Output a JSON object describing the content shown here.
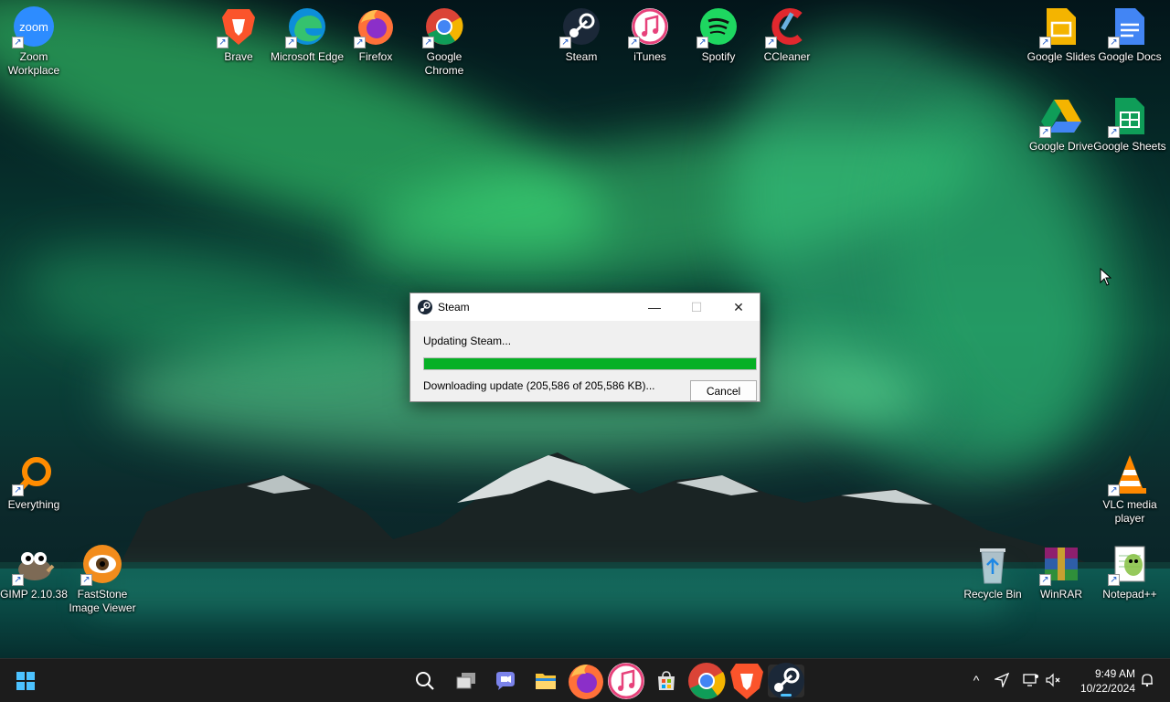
{
  "desktop_icons": [
    {
      "label": "Zoom Workplace",
      "icon": "zoom-icon"
    },
    {
      "label": "Brave",
      "icon": "brave-icon"
    },
    {
      "label": "Microsoft Edge",
      "icon": "edge-icon"
    },
    {
      "label": "Firefox",
      "icon": "firefox-icon"
    },
    {
      "label": "Google Chrome",
      "icon": "chrome-icon"
    },
    {
      "label": "Steam",
      "icon": "steam-icon"
    },
    {
      "label": "iTunes",
      "icon": "itunes-icon"
    },
    {
      "label": "Spotify",
      "icon": "spotify-icon"
    },
    {
      "label": "CCleaner",
      "icon": "ccleaner-icon"
    },
    {
      "label": "Google Slides",
      "icon": "google-slides-icon"
    },
    {
      "label": "Google Docs",
      "icon": "google-docs-icon"
    },
    {
      "label": "Google Drive",
      "icon": "google-drive-icon"
    },
    {
      "label": "Google Sheets",
      "icon": "google-sheets-icon"
    },
    {
      "label": "Everything",
      "icon": "everything-icon"
    },
    {
      "label": "VLC media player",
      "icon": "vlc-icon"
    },
    {
      "label": "GIMP 2.10.38",
      "icon": "gimp-icon"
    },
    {
      "label": "FastStone Image Viewer",
      "icon": "faststone-icon"
    },
    {
      "label": "Recycle Bin",
      "icon": "recycle-bin-icon"
    },
    {
      "label": "WinRAR",
      "icon": "winrar-icon"
    },
    {
      "label": "Notepad++",
      "icon": "notepadpp-icon"
    }
  ],
  "dialog": {
    "title": "Steam",
    "status": "Updating Steam...",
    "progress": 1.0,
    "detail": "Downloading update (205,586 of 205,586 KB)...",
    "cancel_label": "Cancel",
    "minimize_glyph": "—",
    "maximize_glyph": "☐",
    "close_glyph": "✕"
  },
  "taskbar": {
    "items": [
      {
        "icon": "start-icon"
      },
      {
        "icon": "search-icon"
      },
      {
        "icon": "task-view-icon"
      },
      {
        "icon": "chat-icon"
      },
      {
        "icon": "file-explorer-icon"
      },
      {
        "icon": "firefox-icon"
      },
      {
        "icon": "itunes-icon"
      },
      {
        "icon": "microsoft-store-icon"
      },
      {
        "icon": "chrome-icon"
      },
      {
        "icon": "brave-icon"
      },
      {
        "icon": "steam-icon",
        "active": true
      }
    ],
    "tray": {
      "overflow_glyph": "^",
      "time": "9:49 AM",
      "date": "10/22/2024"
    }
  },
  "colors": {
    "progress_fill": "#06b025",
    "taskbar_bg": "#1c1c1c",
    "active_indicator": "#4cc2ff"
  }
}
